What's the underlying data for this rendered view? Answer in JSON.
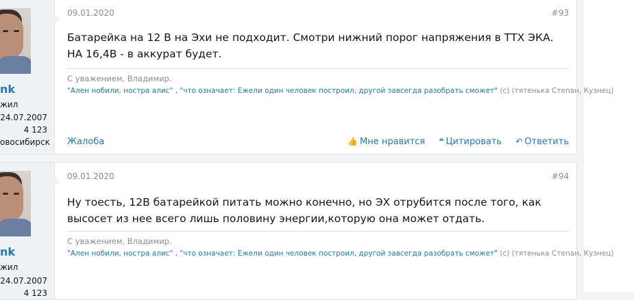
{
  "posts": [
    {
      "date": "09.01.2020",
      "number": "#93",
      "body": "Батарейка на 12 В на Эхи не подходит. Смотри нижний порог напряжения в ТТХ ЭКА. НА 16,4В - в аккурат будет.",
      "signature": "С уважением, Владимир.",
      "quote_links": "\"Ален нобили, ностра алис\" , \"что означает: Ежели один человек построил, другой завсегда разобрать сможет\"",
      "quote_attr": "(с) (тятенька Степан, Кузнец)",
      "user": {
        "name": "nk",
        "role": "жил",
        "joined": "24.07.2007",
        "messages": "4 123",
        "location": "овосибирск"
      },
      "complaint_label": "Жалоба",
      "like_label": "Мне нравится",
      "quote_label": "Цитировать",
      "reply_label": "Ответить"
    },
    {
      "date": "09.01.2020",
      "number": "#94",
      "body": "Ну тоесть, 12В батарейкой питать можно конечно, но ЭХ отрубится после того, как высосет из нее всего лишь половину энергии,которую она может отдать.",
      "signature": "С уважением, Владимир.",
      "quote_links": "\"Ален нобили, ностра алис\" , \"что означает: Ежели один человек построил, другой завсегда разобрать сможет\"",
      "quote_attr": "(с) (тятенька Степан, Кузнец)",
      "user": {
        "name": "nk",
        "role": "жил",
        "joined": "24.07.2007",
        "messages": "4 123"
      }
    }
  ],
  "icons": {
    "like": "thumbs-up-icon",
    "quote": "quote-icon",
    "reply": "reply-icon"
  },
  "colors": {
    "link": "#2577b1",
    "muted": "#8c8c8c",
    "user_cell": "#eff2f4"
  }
}
